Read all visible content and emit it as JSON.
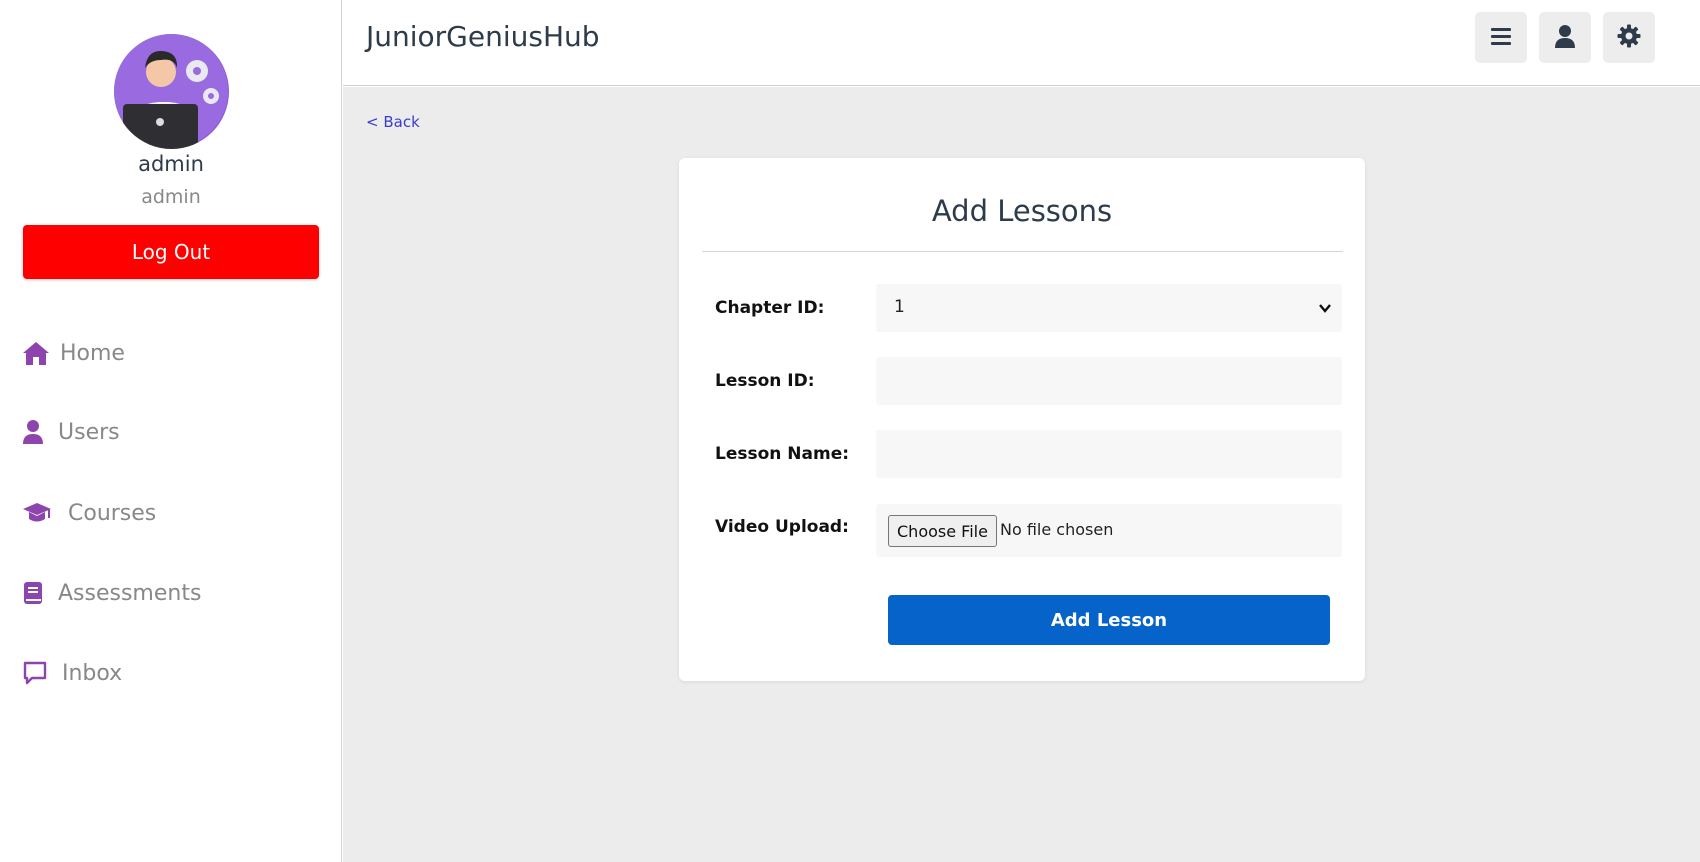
{
  "app": {
    "brand": "JuniorGeniusHub"
  },
  "profile": {
    "name": "admin",
    "role": "admin",
    "logout_label": "Log Out"
  },
  "sidebar": {
    "items": [
      {
        "label": "Home",
        "icon": "home-icon"
      },
      {
        "label": "Users",
        "icon": "user-icon"
      },
      {
        "label": "Courses",
        "icon": "graduation-cap-icon"
      },
      {
        "label": "Assessments",
        "icon": "book-icon"
      },
      {
        "label": "Inbox",
        "icon": "message-icon"
      }
    ]
  },
  "topbar": {
    "buttons": [
      "menu-icon",
      "user-icon",
      "settings-icon"
    ]
  },
  "back_link": "< Back",
  "form": {
    "title": "Add Lessons",
    "chapter_label": "Chapter ID:",
    "chapter_value": "1",
    "lesson_id_label": "Lesson ID:",
    "lesson_id_value": "",
    "lesson_name_label": "Lesson Name:",
    "lesson_name_value": "",
    "video_label": "Video Upload:",
    "choose_file_label": "Choose File",
    "file_status": "No file chosen",
    "submit_label": "Add Lesson"
  },
  "colors": {
    "accent": "#8e44ad",
    "logout": "#ff0000",
    "primary": "#0563c9"
  }
}
